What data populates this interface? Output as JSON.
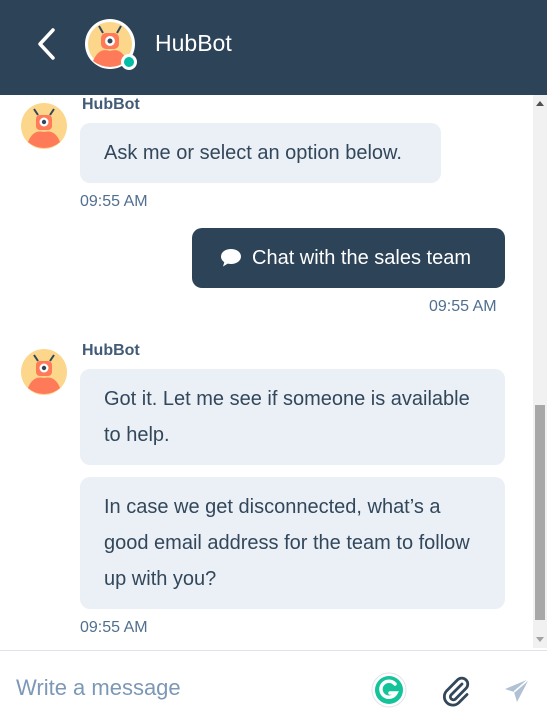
{
  "header": {
    "title": "HubBot",
    "back_icon": "chevron-left-icon",
    "status": "online",
    "status_color": "#00bda5",
    "bg_color": "#2d4358"
  },
  "messages": [
    {
      "sender": "HubBot",
      "bubbles": [
        "Ask me or select an option below."
      ],
      "time": "09:55 AM"
    },
    {
      "sender": "user",
      "text": "Chat with the sales team",
      "icon": "chat-bubble-icon",
      "time": "09:55 AM"
    },
    {
      "sender": "HubBot",
      "bubbles": [
        "Got it. Let me see if someone is available to help.",
        "In case we get disconnected, what’s a good email address for the team to follow up with you?"
      ],
      "time": "09:55 AM"
    }
  ],
  "composer": {
    "placeholder": "Write a message",
    "value": "",
    "grammarly_icon": "grammarly-icon",
    "attach_icon": "paperclip-icon",
    "send_icon": "send-icon"
  }
}
